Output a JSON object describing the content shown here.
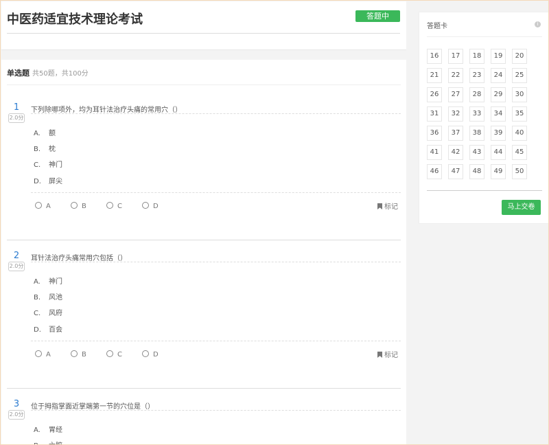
{
  "exam": {
    "title": "中医药适宜技术理论考试",
    "status": "答题中"
  },
  "section": {
    "title": "单选题",
    "subtitle": "共50题，共100分"
  },
  "questions": [
    {
      "num": "1",
      "score": "2.0分",
      "text": "下列除哪项外，均为耳针法治疗头痛的常用穴（）",
      "options": [
        {
          "letter": "A.",
          "text": "额"
        },
        {
          "letter": "B.",
          "text": "枕"
        },
        {
          "letter": "C.",
          "text": "神门"
        },
        {
          "letter": "D.",
          "text": "屏尖"
        }
      ],
      "answers": [
        "A",
        "B",
        "C",
        "D"
      ],
      "mark": "标记"
    },
    {
      "num": "2",
      "score": "2.0分",
      "text": "耳针法治疗头痛常用穴包括（）",
      "options": [
        {
          "letter": "A.",
          "text": "神门"
        },
        {
          "letter": "B.",
          "text": "风池"
        },
        {
          "letter": "C.",
          "text": "风府"
        },
        {
          "letter": "D.",
          "text": "百会"
        }
      ],
      "answers": [
        "A",
        "B",
        "C",
        "D"
      ],
      "mark": "标记"
    },
    {
      "num": "3",
      "score": "2.0分",
      "text": "位于拇指掌面近掌端第一节的穴位是（）",
      "options": [
        {
          "letter": "A.",
          "text": "胃经"
        },
        {
          "letter": "B.",
          "text": "六腑"
        }
      ]
    }
  ],
  "answer_card": {
    "title": "答题卡",
    "info_icon": "info-icon",
    "numbers": [
      "16",
      "17",
      "18",
      "19",
      "20",
      "21",
      "22",
      "23",
      "24",
      "25",
      "26",
      "27",
      "28",
      "29",
      "30",
      "31",
      "32",
      "33",
      "34",
      "35",
      "36",
      "37",
      "38",
      "39",
      "40",
      "41",
      "42",
      "43",
      "44",
      "45",
      "46",
      "47",
      "48",
      "49",
      "50"
    ],
    "submit": "马上交卷"
  },
  "colors": {
    "accent": "#3bb85a",
    "number": "#2b7bd0"
  }
}
